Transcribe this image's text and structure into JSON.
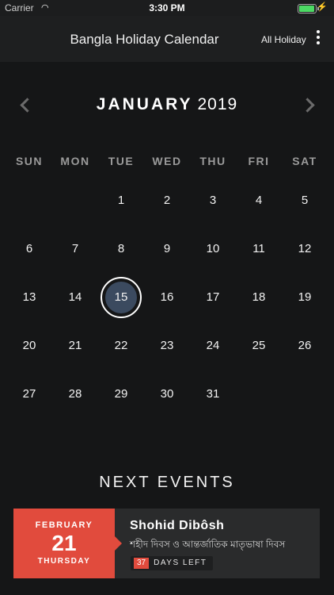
{
  "status_bar": {
    "carrier": "Carrier",
    "time": "3:30 PM"
  },
  "nav": {
    "title": "Bangla Holiday Calendar",
    "filter_label": "All Holiday"
  },
  "calendar": {
    "month": "JANUARY",
    "year": "2019",
    "weekdays": [
      "SUN",
      "MON",
      "TUE",
      "WED",
      "THU",
      "FRI",
      "SAT"
    ],
    "days": [
      "",
      "",
      "1",
      "2",
      "3",
      "4",
      "5",
      "6",
      "7",
      "8",
      "9",
      "10",
      "11",
      "12",
      "13",
      "14",
      "15",
      "16",
      "17",
      "18",
      "19",
      "20",
      "21",
      "22",
      "23",
      "24",
      "25",
      "26",
      "27",
      "28",
      "29",
      "30",
      "31",
      "",
      "",
      "",
      ""
    ],
    "selected_day": "15"
  },
  "events": {
    "title": "NEXT EVENTS",
    "items": [
      {
        "month": "FEBRUARY",
        "day": "21",
        "weekday": "THURSDAY",
        "name": "Shohid Dibôsh",
        "description": "শহীদ দিবস ও আন্তর্জাতিক মাতৃভাষা দিবস",
        "days_left_count": "37",
        "days_left_label": "DAYS LEFT"
      }
    ]
  },
  "colors": {
    "accent": "#e14b3d",
    "selected": "#3b4a5f",
    "background": "#151617"
  }
}
